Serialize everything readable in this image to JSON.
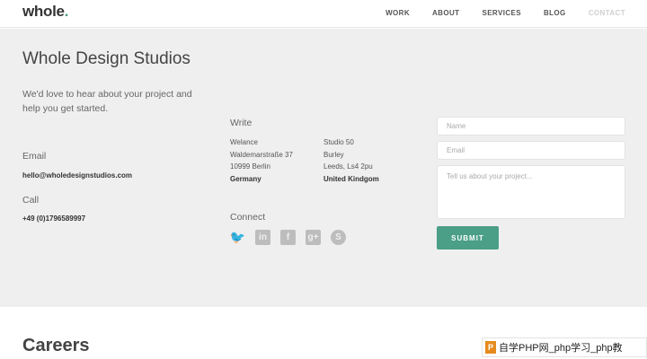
{
  "header": {
    "logo_text": "whole",
    "logo_dot": ".",
    "nav": [
      {
        "label": "WORK"
      },
      {
        "label": "ABOUT"
      },
      {
        "label": "SERVICES"
      },
      {
        "label": "BLOG"
      },
      {
        "label": "CONTACT",
        "active": true
      }
    ]
  },
  "contact": {
    "title": "Whole Design Studios",
    "intro": "We'd love to hear about your project and help you get started.",
    "email_heading": "Email",
    "email": "hello@wholedesignstudios.com",
    "call_heading": "Call",
    "phone": "+49 (0)1796589997",
    "write_heading": "Write",
    "address_berlin": [
      "Welance",
      "Waldemarstraße 37",
      "10999 Berlin",
      "Germany"
    ],
    "address_leeds": [
      "Studio 50",
      "Burley",
      "Leeds, Ls4 2pu",
      "United Kindgom"
    ],
    "connect_heading": "Connect",
    "socials": [
      {
        "icon": "twitter-icon",
        "glyph": "🐦"
      },
      {
        "icon": "linkedin-icon",
        "glyph": "in"
      },
      {
        "icon": "facebook-icon",
        "glyph": "f"
      },
      {
        "icon": "google-plus-icon",
        "glyph": "g+"
      },
      {
        "icon": "skype-icon",
        "glyph": "S"
      }
    ],
    "form": {
      "name_placeholder": "Name",
      "email_placeholder": "Email",
      "message_placeholder": "Tell us about your project...",
      "submit_label": "SUBMIT"
    }
  },
  "careers_title": "Careers",
  "watermark": {
    "mark": "P",
    "text": "自学PHP网_php学习_php教"
  },
  "colors": {
    "accent": "#4a9f86",
    "background": "#efefef"
  }
}
